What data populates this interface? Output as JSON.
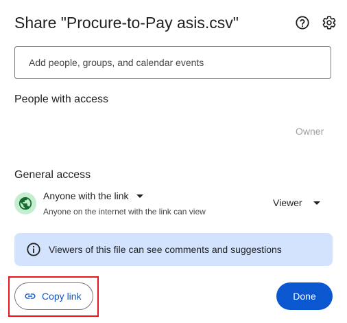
{
  "dialog": {
    "title": "Share \"Procure-to-Pay asis.csv\"",
    "icons": {
      "help": "help-circle-icon",
      "settings": "gear-icon"
    }
  },
  "share_input": {
    "placeholder": "Add people, groups, and calendar events",
    "value": ""
  },
  "people_with_access": {
    "title": "People with access",
    "owner_label": "Owner"
  },
  "general_access": {
    "title": "General access",
    "icon": "globe-icon",
    "access_level": "Anyone with the link",
    "access_description": "Anyone on the internet with the link can view",
    "role": "Viewer"
  },
  "info_banner": {
    "icon": "info-icon",
    "text": "Viewers of this file can see comments and suggestions"
  },
  "footer": {
    "copy_link_label": "Copy link",
    "copy_link_icon": "link-icon",
    "done_label": "Done"
  },
  "colors": {
    "accent": "#0b57d0",
    "info_banner_bg": "#d3e3fd",
    "globe_bg": "#c4eed0",
    "globe_fg": "#146c2e",
    "highlight": "#e5141d"
  }
}
